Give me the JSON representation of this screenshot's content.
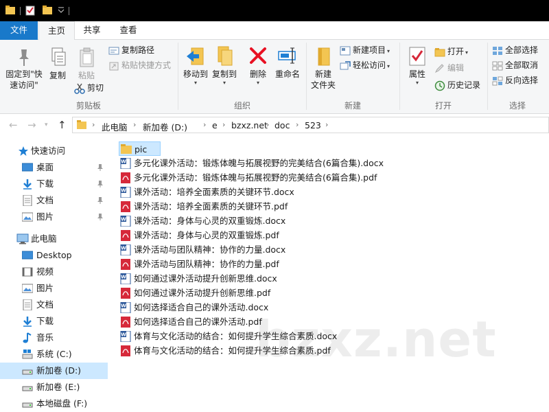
{
  "ribbon_tabs": {
    "file": "文件",
    "home": "主页",
    "share": "共享",
    "view": "查看"
  },
  "ribbon": {
    "clipboard": {
      "group_label": "剪贴板",
      "pin_line1": "固定到\"快",
      "pin_line2": "速访问\"",
      "copy": "复制",
      "paste": "粘贴",
      "copy_path": "复制路径",
      "paste_shortcut": "粘贴快捷方式",
      "cut": "剪切"
    },
    "organize": {
      "group_label": "组织",
      "move_to": "移动到",
      "copy_to": "复制到",
      "delete": "删除",
      "rename": "重命名"
    },
    "new": {
      "group_label": "新建",
      "new_folder_line1": "新建",
      "new_folder_line2": "文件夹",
      "new_item": "新建项目",
      "easy_access": "轻松访问"
    },
    "open": {
      "group_label": "打开",
      "properties": "属性",
      "open": "打开",
      "edit": "编辑",
      "history": "历史记录"
    },
    "select": {
      "group_label": "选择",
      "select_all": "全部选择",
      "select_none": "全部取消",
      "invert": "反向选择"
    }
  },
  "address": {
    "crumbs": [
      "此电脑",
      "新加卷 (D:)",
      "e",
      "bzxz.net",
      "doc",
      "523"
    ]
  },
  "nav": {
    "quick_access": "快速访问",
    "quick_items": [
      "桌面",
      "下载",
      "文档",
      "图片"
    ],
    "this_pc": "此电脑",
    "pc_items": [
      "Desktop",
      "视频",
      "图片",
      "文档",
      "下载",
      "音乐",
      "系统 (C:)",
      "新加卷 (D:)",
      "新加卷 (E:)",
      "本地磁盘 (F:)"
    ]
  },
  "files": [
    {
      "name": "pic",
      "type": "folder"
    },
    {
      "name": "多元化课外活动：锻炼体魄与拓展视野的完美结合(6篇合集).docx",
      "type": "docx"
    },
    {
      "name": "多元化课外活动：锻炼体魄与拓展视野的完美结合(6篇合集).pdf",
      "type": "pdf"
    },
    {
      "name": "课外活动：培养全面素质的关键环节.docx",
      "type": "docx"
    },
    {
      "name": "课外活动：培养全面素质的关键环节.pdf",
      "type": "pdf"
    },
    {
      "name": "课外活动：身体与心灵的双重锻炼.docx",
      "type": "docx"
    },
    {
      "name": "课外活动：身体与心灵的双重锻炼.pdf",
      "type": "pdf"
    },
    {
      "name": "课外活动与团队精神：协作的力量.docx",
      "type": "docx"
    },
    {
      "name": "课外活动与团队精神：协作的力量.pdf",
      "type": "pdf"
    },
    {
      "name": "如何通过课外活动提升创新思维.docx",
      "type": "docx"
    },
    {
      "name": "如何通过课外活动提升创新思维.pdf",
      "type": "pdf"
    },
    {
      "name": "如何选择适合自己的课外活动.docx",
      "type": "docx"
    },
    {
      "name": "如何选择适合自己的课外活动.pdf",
      "type": "pdf"
    },
    {
      "name": "体育与文化活动的结合：如何提升学生综合素质.docx",
      "type": "docx"
    },
    {
      "name": "体育与文化活动的结合：如何提升学生综合素质.pdf",
      "type": "pdf"
    }
  ],
  "watermark": "bzxz.net",
  "colors": {
    "accent": "#1979ca",
    "selection": "#cce8ff",
    "folder": "#f3c552",
    "pdf": "#d6293a",
    "word": "#2b579a",
    "delete_red": "#e81123"
  }
}
